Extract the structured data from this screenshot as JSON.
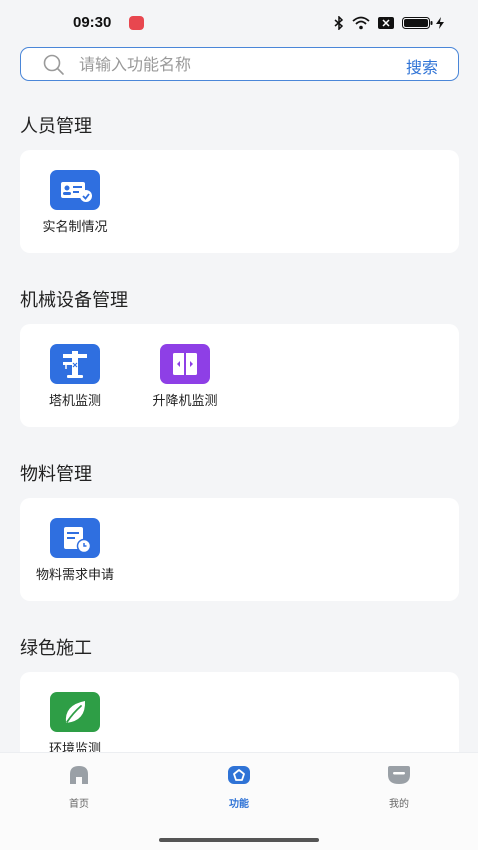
{
  "status_bar": {
    "time": "09:30"
  },
  "search": {
    "placeholder": "请输入功能名称",
    "button_label": "搜索"
  },
  "sections": [
    {
      "title": "人员管理",
      "items": [
        {
          "label": "实名制情况",
          "icon": "id-card-check-icon",
          "color": "#2f6fe0"
        }
      ]
    },
    {
      "title": "机械设备管理",
      "items": [
        {
          "label": "塔机监测",
          "icon": "tower-crane-icon",
          "color": "#2f6fe0"
        },
        {
          "label": "升降机监测",
          "icon": "elevator-icon",
          "color": "#8e3fe6"
        }
      ]
    },
    {
      "title": "物料管理",
      "items": [
        {
          "label": "物料需求申请",
          "icon": "material-request-icon",
          "color": "#2f6fe0"
        }
      ]
    },
    {
      "title": "绿色施工",
      "items": [
        {
          "label": "环境监测",
          "icon": "leaf-icon",
          "color": "#2e9e46"
        }
      ]
    }
  ],
  "tab_bar": {
    "tabs": [
      {
        "label": "首页",
        "icon": "home-icon",
        "active": false
      },
      {
        "label": "功能",
        "icon": "function-icon",
        "active": true
      },
      {
        "label": "我的",
        "icon": "profile-icon",
        "active": false
      }
    ],
    "accent_color": "#2f73d6"
  }
}
